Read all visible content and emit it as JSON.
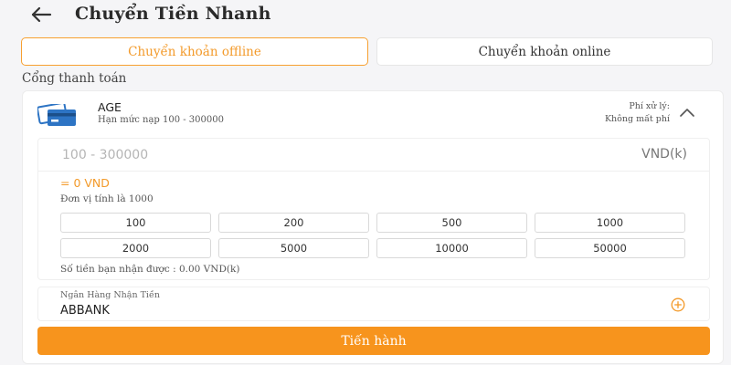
{
  "header": {
    "title": "Chuyển Tiền Nhanh",
    "back_icon": "arrow-left-icon"
  },
  "tabs": [
    {
      "label": "Chuyển khoản offline",
      "active": true
    },
    {
      "label": "Chuyển khoản online",
      "active": false
    }
  ],
  "section_label": "Cổng thanh toán",
  "gateway": {
    "icon": "credit-card-icon",
    "name": "AGE",
    "limit": "Hạn mức nạp 100 - 300000",
    "fee_label": "Phí xử lý:",
    "fee_value": "Không mất phí",
    "expanded": true
  },
  "form": {
    "amount_placeholder": "100 - 300000",
    "amount_value": "",
    "currency_unit": "VND(k)",
    "converted_amount": "= 0 VND",
    "unit_note": "Đơn vị tính là 1000",
    "quick_amounts": [
      "100",
      "200",
      "500",
      "1000",
      "2000",
      "5000",
      "10000",
      "50000"
    ],
    "receive_note": "Số tiền bạn nhận được : 0.00 VND(k)"
  },
  "bank": {
    "label": "Ngân Hàng Nhận Tiền",
    "value": "ABBANK"
  },
  "submit_label": "Tiến hành",
  "colors": {
    "accent": "#f7941d",
    "accent_text": "#f39a2a",
    "background": "#f5f5f7",
    "card_blue": "#2d74c4"
  }
}
